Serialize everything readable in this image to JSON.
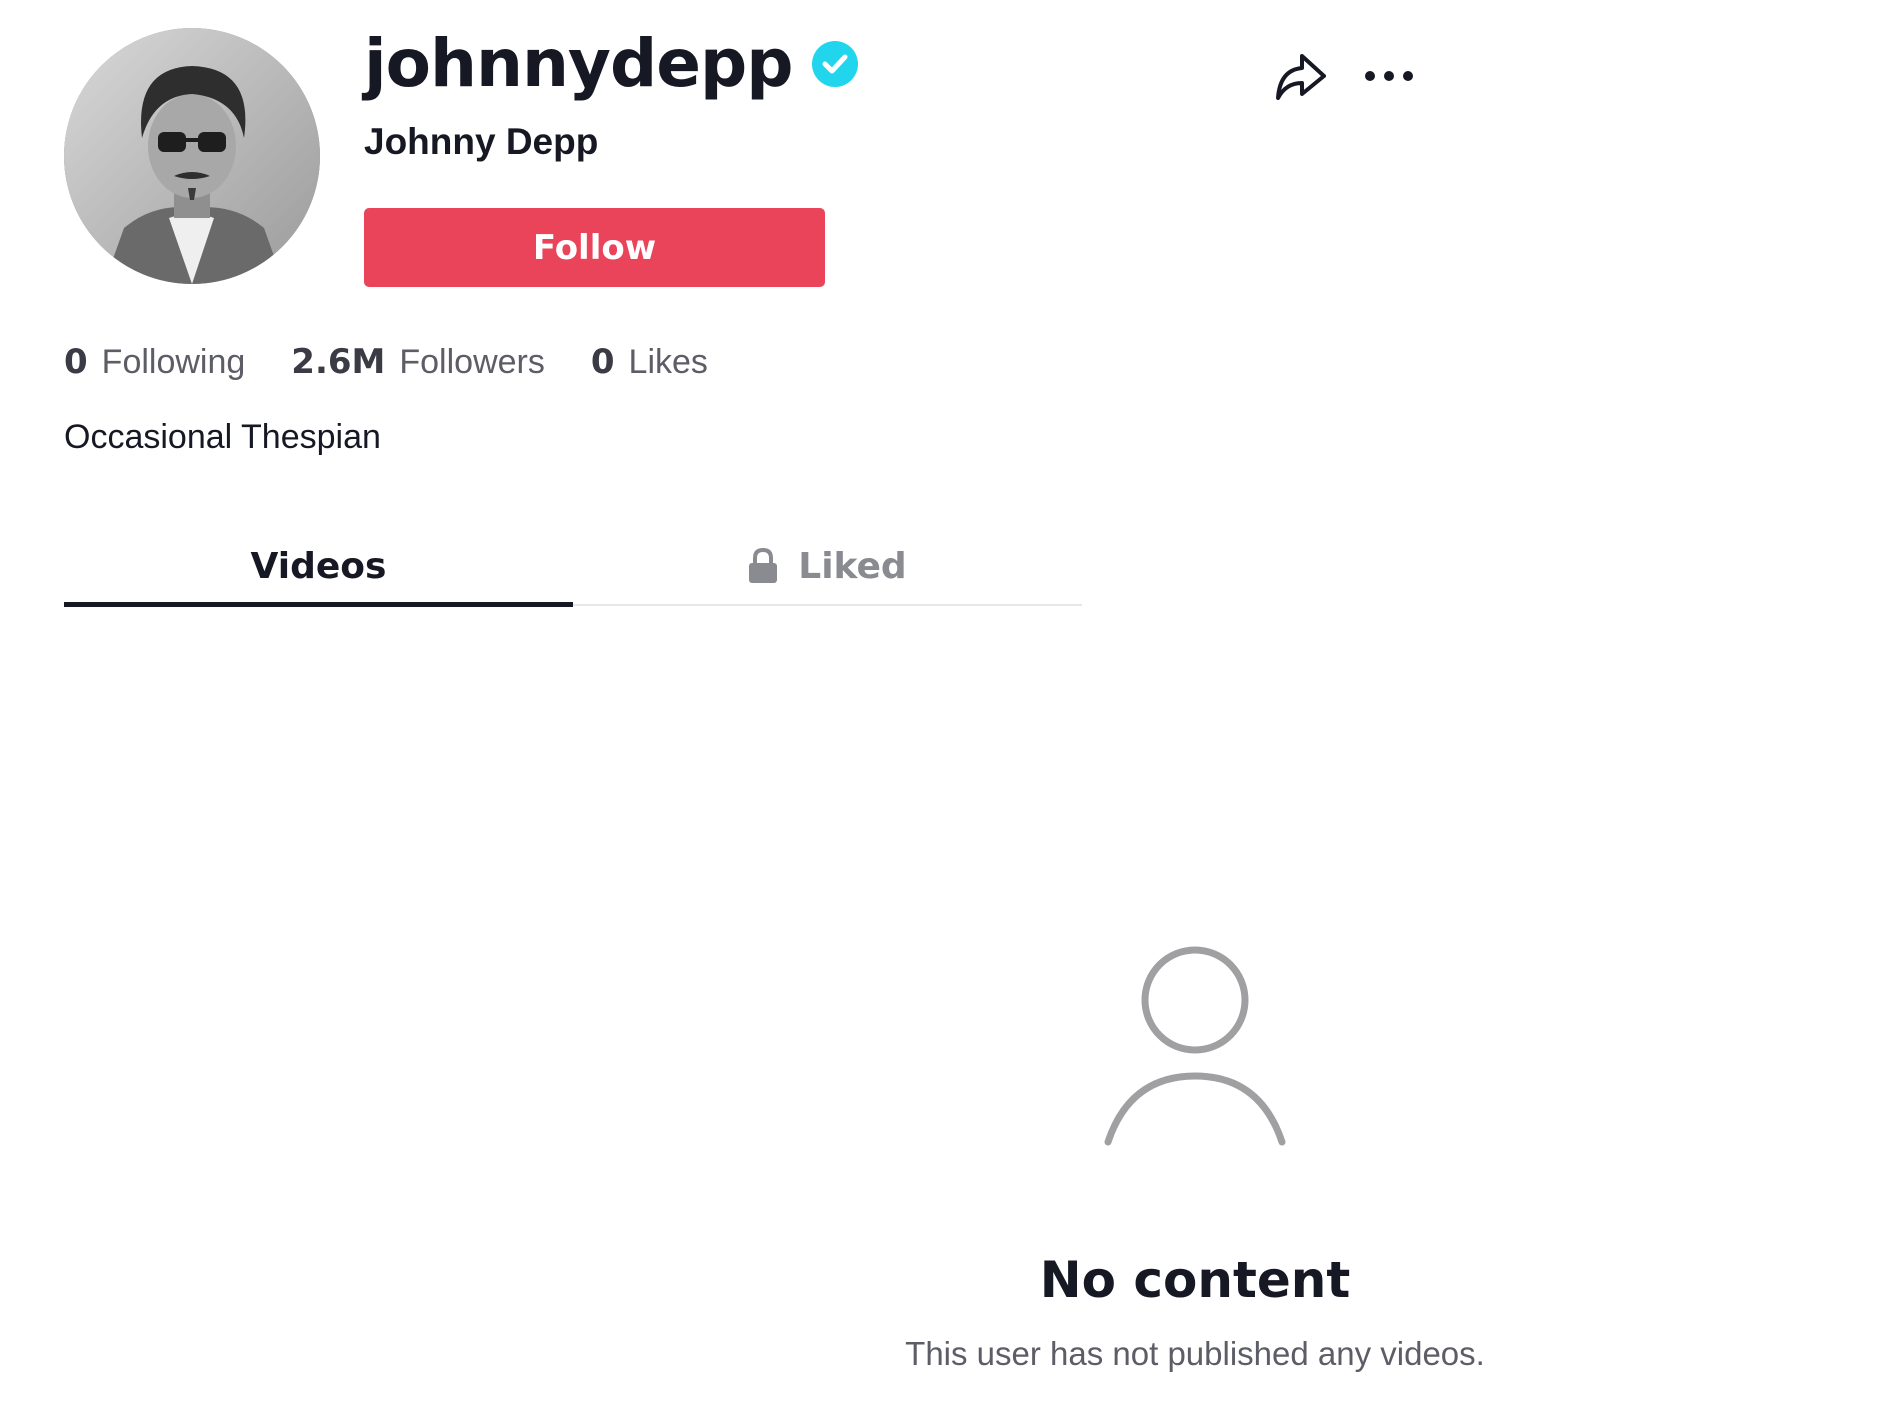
{
  "profile": {
    "username": "johnnydepp",
    "display_name": "Johnny Depp",
    "verified": true,
    "bio": "Occasional Thespian",
    "follow_label": "Follow"
  },
  "stats": {
    "following": {
      "value": "0",
      "label": "Following"
    },
    "followers": {
      "value": "2.6M",
      "label": "Followers"
    },
    "likes": {
      "value": "0",
      "label": "Likes"
    }
  },
  "tabs": [
    {
      "label": "Videos",
      "active": true
    },
    {
      "label": "Liked",
      "active": false,
      "icon": "lock-icon"
    }
  ],
  "empty_state": {
    "icon": "user-icon",
    "title": "No content",
    "subtitle": "This user has not published any videos."
  },
  "icons": {
    "share": "share-icon",
    "more": "more-options-icon",
    "verified": "verified-badge-icon"
  },
  "colors": {
    "follow_button": "#ea445a",
    "verified_badge": "#20d5ec",
    "text_primary": "#161823",
    "text_secondary": "#5c5d66",
    "empty_icon": "#a0a0a3"
  }
}
